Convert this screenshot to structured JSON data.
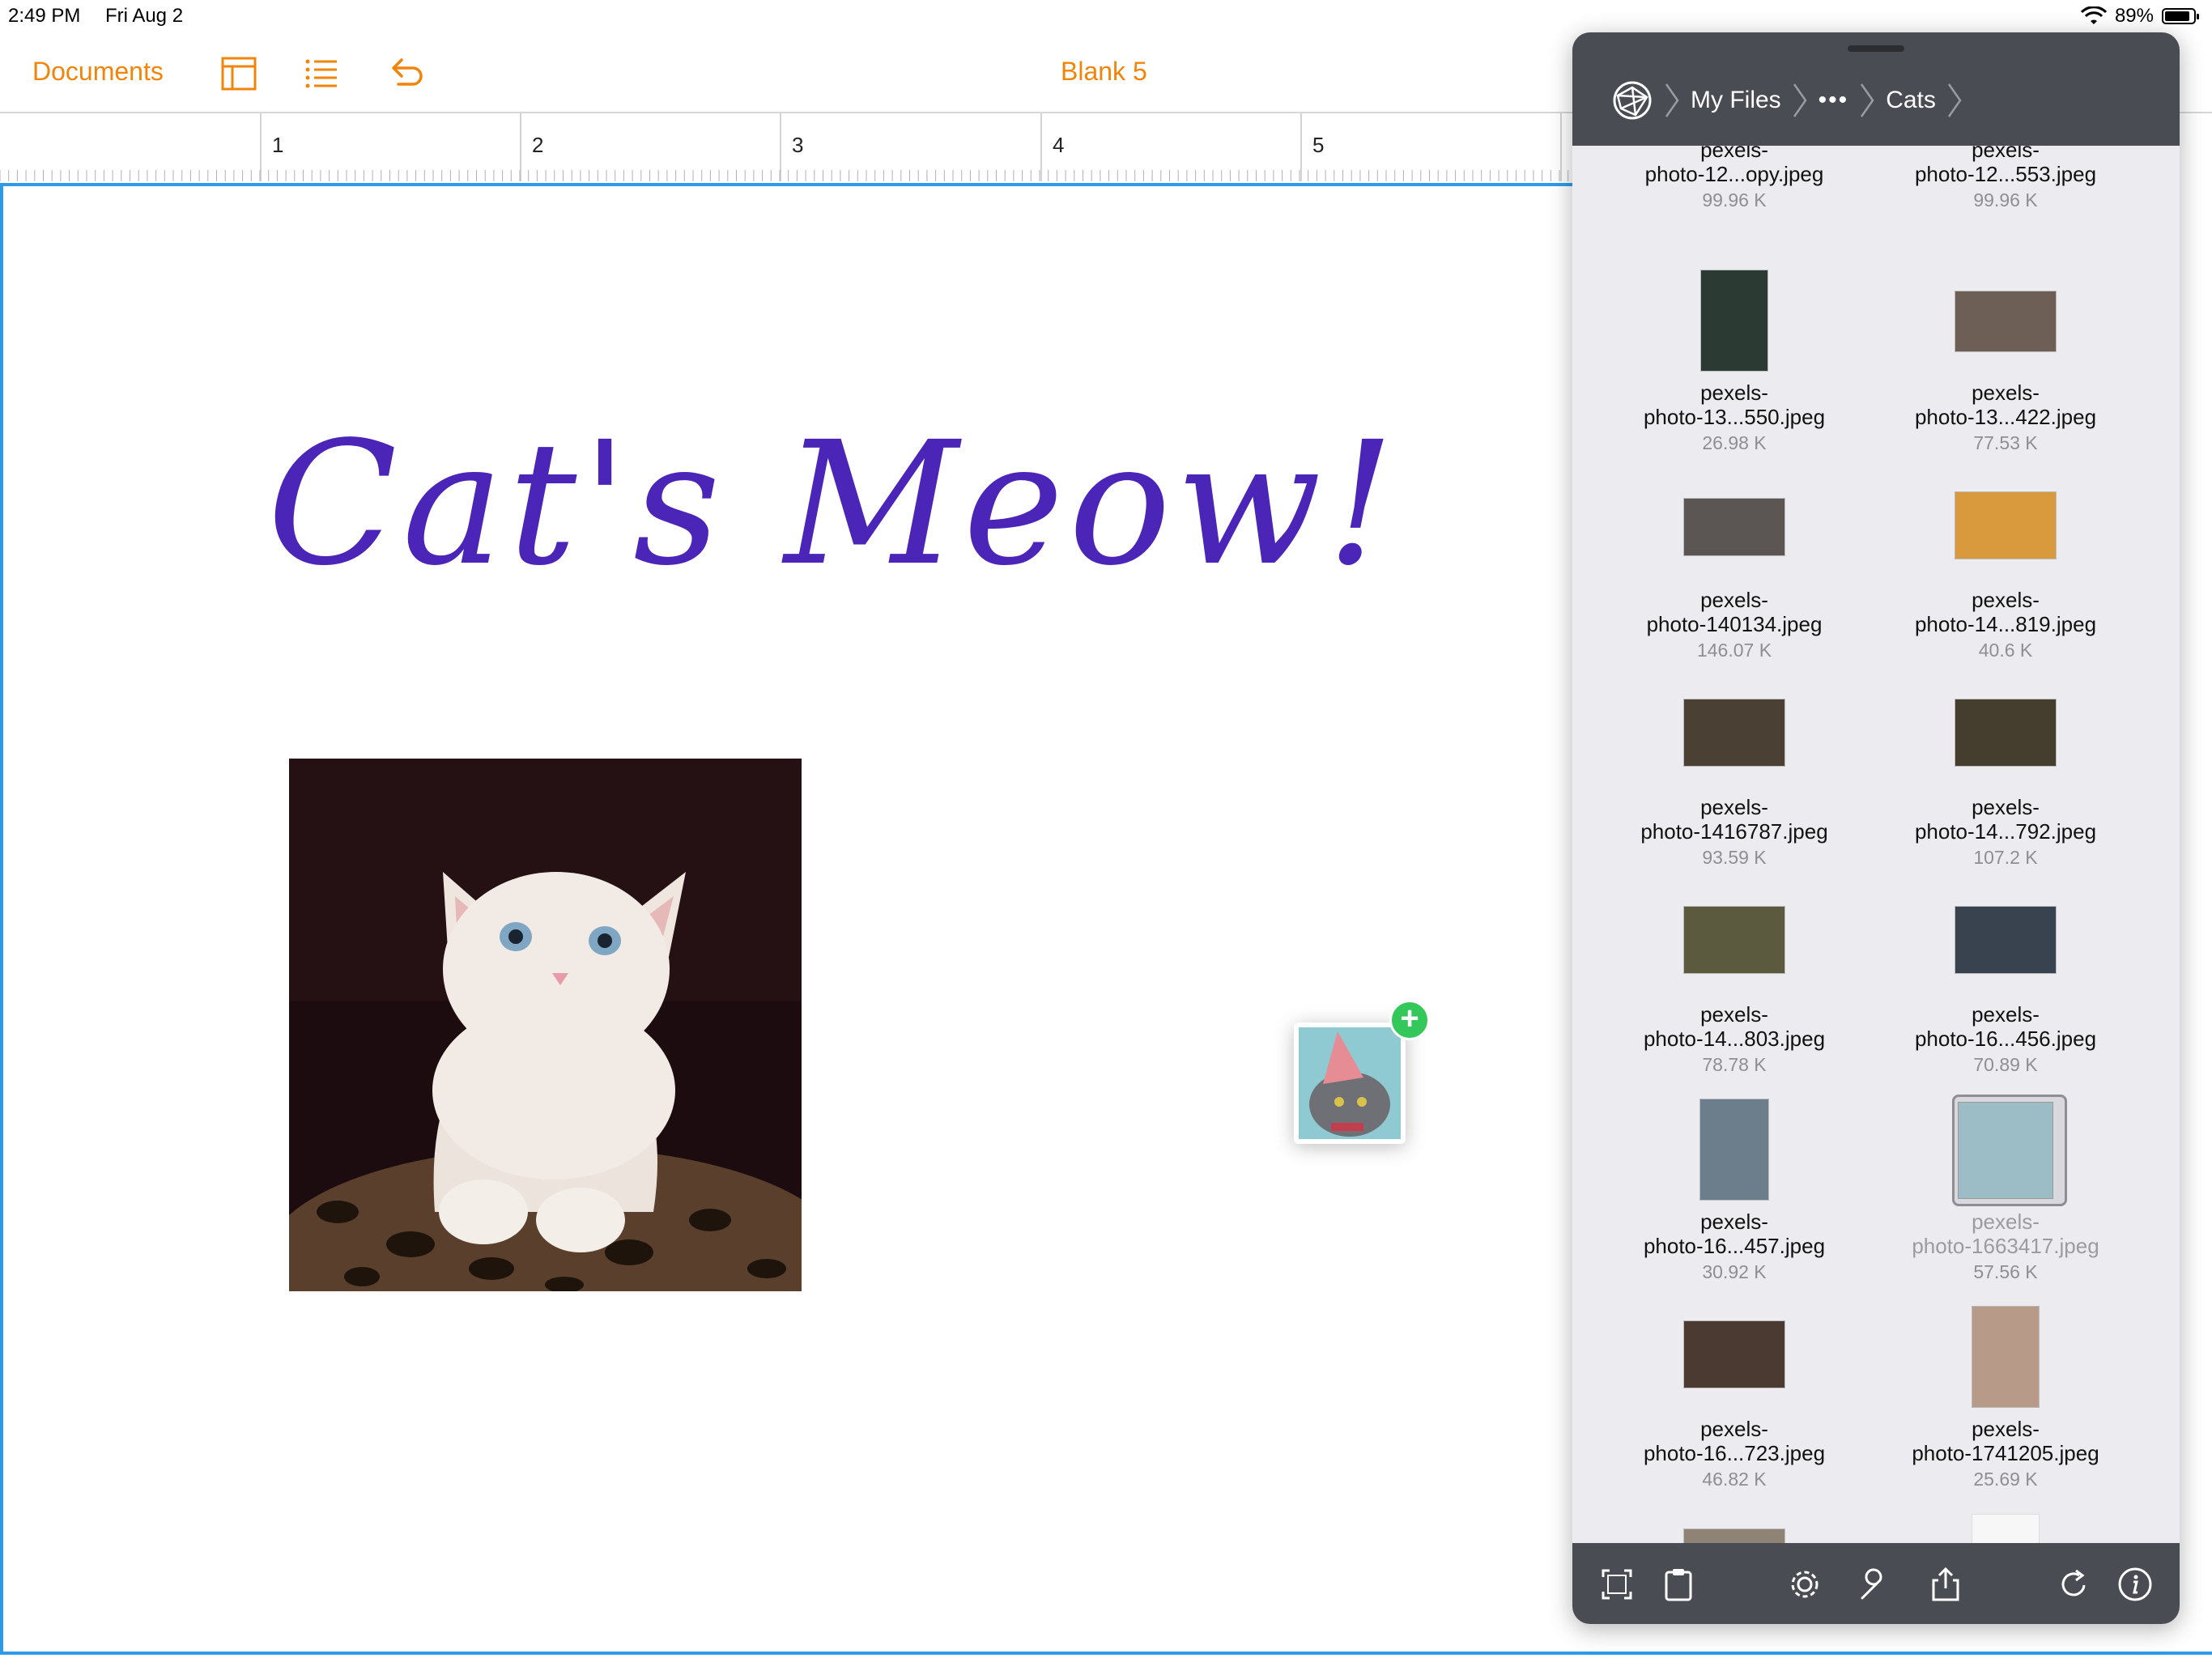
{
  "status": {
    "time": "2:49 PM",
    "date": "Fri Aug 2",
    "battery": "89%"
  },
  "toolbar": {
    "documents_label": "Documents",
    "title": "Blank 5"
  },
  "ruler": {
    "numbers": [
      "1",
      "2",
      "3",
      "4",
      "5"
    ]
  },
  "document": {
    "headline": "Cat's Meow!"
  },
  "files_panel": {
    "breadcrumbs": [
      "My Files",
      "•••",
      "Cats"
    ],
    "files": [
      {
        "line1": "pexels-",
        "line2": "photo-12...opy.jpeg",
        "size": "99.96 K"
      },
      {
        "line1": "pexels-",
        "line2": "photo-12...553.jpeg",
        "size": "99.96 K"
      },
      {
        "line1": "pexels-",
        "line2": "photo-13...550.jpeg",
        "size": "26.98 K"
      },
      {
        "line1": "pexels-",
        "line2": "photo-13...422.jpeg",
        "size": "77.53 K"
      },
      {
        "line1": "pexels-",
        "line2": "photo-140134.jpeg",
        "size": "146.07 K"
      },
      {
        "line1": "pexels-",
        "line2": "photo-14...819.jpeg",
        "size": "40.6 K"
      },
      {
        "line1": "pexels-",
        "line2": "photo-1416787.jpeg",
        "size": "93.59 K"
      },
      {
        "line1": "pexels-",
        "line2": "photo-14...792.jpeg",
        "size": "107.2 K"
      },
      {
        "line1": "pexels-",
        "line2": "photo-14...803.jpeg",
        "size": "78.78 K"
      },
      {
        "line1": "pexels-",
        "line2": "photo-16...456.jpeg",
        "size": "70.89 K"
      },
      {
        "line1": "pexels-",
        "line2": "photo-16...457.jpeg",
        "size": "30.92 K"
      },
      {
        "line1": "pexels-",
        "line2": "photo-1663417.jpeg",
        "size": "57.56 K"
      },
      {
        "line1": "pexels-",
        "line2": "photo-16...723.jpeg",
        "size": "46.82 K"
      },
      {
        "line1": "pexels-",
        "line2": "photo-1741205.jpeg",
        "size": "25.69 K"
      }
    ]
  },
  "colors": {
    "accent": "#f0850a",
    "headline": "#4b24b8",
    "selection": "#2d9be8",
    "drop_plus": "#34c759"
  },
  "icons": {
    "footer": [
      "expand-icon",
      "clipboard-icon",
      "gear-icon",
      "wrench-icon",
      "share-icon",
      "refresh-icon",
      "info-icon"
    ]
  }
}
